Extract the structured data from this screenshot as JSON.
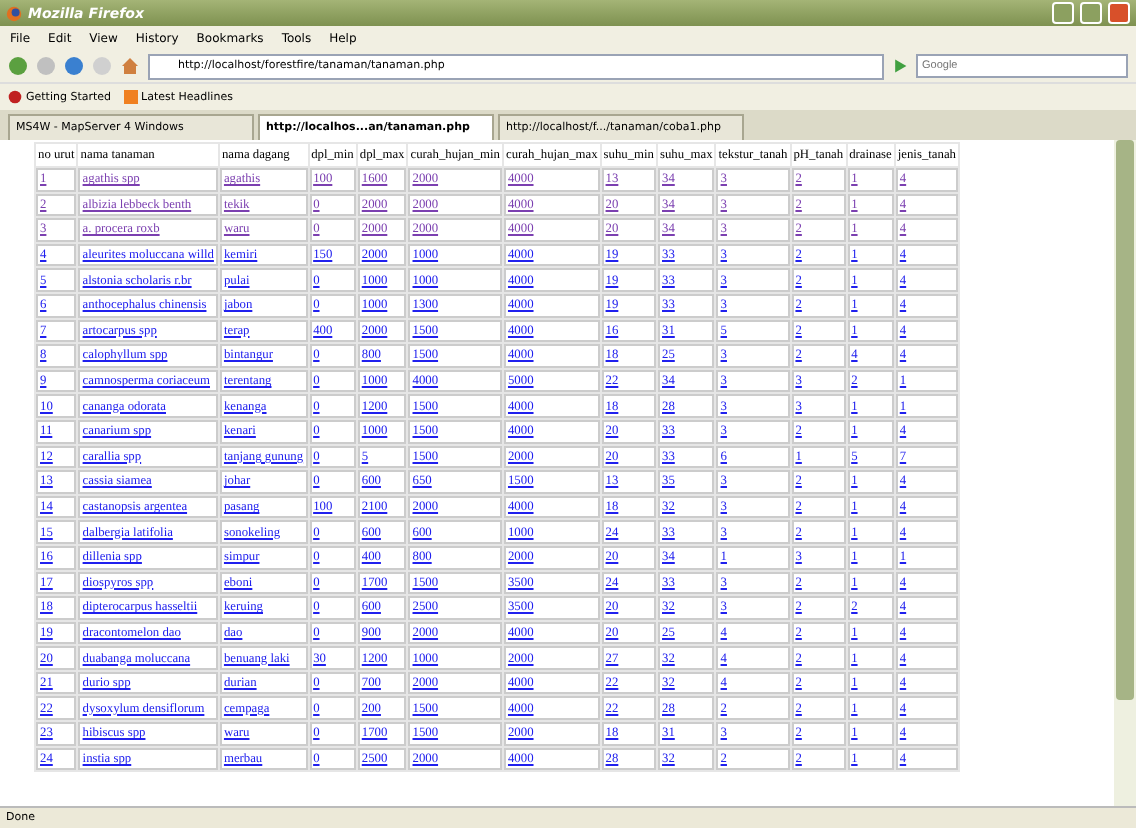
{
  "window": {
    "title": "Mozilla Firefox"
  },
  "menu": [
    "File",
    "Edit",
    "View",
    "History",
    "Bookmarks",
    "Tools",
    "Help"
  ],
  "address_bar": {
    "value": "http://localhost/forestfire/tanaman/tanaman.php"
  },
  "search": {
    "placeholder": "Google"
  },
  "bookmarks": [
    {
      "label": "Getting Started",
      "kind": "star"
    },
    {
      "label": "Latest Headlines",
      "kind": "feed"
    }
  ],
  "tabs": [
    {
      "label": "MS4W - MapServer 4 Windows",
      "selected": false
    },
    {
      "label": "http://localhos...an/tanaman.php",
      "selected": true
    },
    {
      "label": "http://localhost/f.../tanaman/coba1.php",
      "selected": false
    }
  ],
  "table": {
    "columns": [
      "no urut",
      "nama tanaman",
      "nama dagang",
      "dpl_min",
      "dpl_max",
      "curah_hujan_min",
      "curah_hujan_max",
      "suhu_min",
      "suhu_max",
      "tekstur_tanah",
      "pH_tanah",
      "drainase",
      "jenis_tanah"
    ],
    "rows": [
      {
        "visited": true,
        "cells": [
          "1",
          "agathis spp",
          "agathis",
          "100",
          "1600",
          "2000",
          "4000",
          "13",
          "34",
          "3",
          "2",
          "1",
          "4"
        ]
      },
      {
        "visited": true,
        "cells": [
          "2",
          "albizia lebbeck benth",
          "tekik",
          "0",
          "2000",
          "2000",
          "4000",
          "20",
          "34",
          "3",
          "2",
          "1",
          "4"
        ]
      },
      {
        "visited": true,
        "cells": [
          "3",
          "a. procera roxb",
          "waru",
          "0",
          "2000",
          "2000",
          "4000",
          "20",
          "34",
          "3",
          "2",
          "1",
          "4"
        ]
      },
      {
        "visited": false,
        "cells": [
          "4",
          "aleurites moluccana willd",
          "kemiri",
          "150",
          "2000",
          "1000",
          "4000",
          "19",
          "33",
          "3",
          "2",
          "1",
          "4"
        ]
      },
      {
        "visited": false,
        "cells": [
          "5",
          "alstonia scholaris r.br",
          "pulai",
          "0",
          "1000",
          "1000",
          "4000",
          "19",
          "33",
          "3",
          "2",
          "1",
          "4"
        ]
      },
      {
        "visited": false,
        "cells": [
          "6",
          "anthocephalus chinensis",
          "jabon",
          "0",
          "1000",
          "1300",
          "4000",
          "19",
          "33",
          "3",
          "2",
          "1",
          "4"
        ]
      },
      {
        "visited": false,
        "cells": [
          "7",
          "artocarpus spp",
          "terap",
          "400",
          "2000",
          "1500",
          "4000",
          "16",
          "31",
          "5",
          "2",
          "1",
          "4"
        ]
      },
      {
        "visited": false,
        "cells": [
          "8",
          "calophyllum spp",
          "bintangur",
          "0",
          "800",
          "1500",
          "4000",
          "18",
          "25",
          "3",
          "2",
          "4",
          "4"
        ]
      },
      {
        "visited": false,
        "cells": [
          "9",
          "camnosperma coriaceum",
          "terentang",
          "0",
          "1000",
          "4000",
          "5000",
          "22",
          "34",
          "3",
          "3",
          "2",
          "1"
        ]
      },
      {
        "visited": false,
        "cells": [
          "10",
          "cananga odorata",
          "kenanga",
          "0",
          "1200",
          "1500",
          "4000",
          "18",
          "28",
          "3",
          "3",
          "1",
          "1"
        ]
      },
      {
        "visited": false,
        "cells": [
          "11",
          "canarium spp",
          "kenari",
          "0",
          "1000",
          "1500",
          "4000",
          "20",
          "33",
          "3",
          "2",
          "1",
          "4"
        ]
      },
      {
        "visited": false,
        "cells": [
          "12",
          "carallia spp",
          "tanjang gunung",
          "0",
          "5",
          "1500",
          "2000",
          "20",
          "33",
          "6",
          "1",
          "5",
          "7"
        ]
      },
      {
        "visited": false,
        "cells": [
          "13",
          "cassia siamea",
          "johar",
          "0",
          "600",
          "650",
          "1500",
          "13",
          "35",
          "3",
          "2",
          "1",
          "4"
        ]
      },
      {
        "visited": false,
        "cells": [
          "14",
          "castanopsis argentea",
          "pasang",
          "100",
          "2100",
          "2000",
          "4000",
          "18",
          "32",
          "3",
          "2",
          "1",
          "4"
        ]
      },
      {
        "visited": false,
        "cells": [
          "15",
          "dalbergia latifolia",
          "sonokeling",
          "0",
          "600",
          "600",
          "1000",
          "24",
          "33",
          "3",
          "2",
          "1",
          "4"
        ]
      },
      {
        "visited": false,
        "cells": [
          "16",
          "dillenia spp",
          "simpur",
          "0",
          "400",
          "800",
          "2000",
          "20",
          "34",
          "1",
          "3",
          "1",
          "1"
        ]
      },
      {
        "visited": false,
        "cells": [
          "17",
          "diospyros spp",
          "eboni",
          "0",
          "1700",
          "1500",
          "3500",
          "24",
          "33",
          "3",
          "2",
          "1",
          "4"
        ]
      },
      {
        "visited": false,
        "cells": [
          "18",
          "dipterocarpus hasseltii",
          "keruing",
          "0",
          "600",
          "2500",
          "3500",
          "20",
          "32",
          "3",
          "2",
          "2",
          "4"
        ]
      },
      {
        "visited": false,
        "cells": [
          "19",
          "dracontomelon dao",
          "dao",
          "0",
          "900",
          "2000",
          "4000",
          "20",
          "25",
          "4",
          "2",
          "1",
          "4"
        ]
      },
      {
        "visited": false,
        "cells": [
          "20",
          "duabanga moluccana",
          "benuang laki",
          "30",
          "1200",
          "1000",
          "2000",
          "27",
          "32",
          "4",
          "2",
          "1",
          "4"
        ]
      },
      {
        "visited": false,
        "cells": [
          "21",
          "durio spp",
          "durian",
          "0",
          "700",
          "2000",
          "4000",
          "22",
          "32",
          "4",
          "2",
          "1",
          "4"
        ]
      },
      {
        "visited": false,
        "cells": [
          "22",
          "dysoxylum densiflorum",
          "cempaga",
          "0",
          "200",
          "1500",
          "4000",
          "22",
          "28",
          "2",
          "2",
          "1",
          "4"
        ]
      },
      {
        "visited": false,
        "cells": [
          "23",
          "hibiscus spp",
          "waru",
          "0",
          "1700",
          "1500",
          "2000",
          "18",
          "31",
          "3",
          "2",
          "1",
          "4"
        ]
      },
      {
        "visited": false,
        "cells": [
          "24",
          "instia spp",
          "merbau",
          "0",
          "2500",
          "2000",
          "4000",
          "28",
          "32",
          "2",
          "2",
          "1",
          "4"
        ]
      }
    ]
  },
  "status_bar": "Done"
}
